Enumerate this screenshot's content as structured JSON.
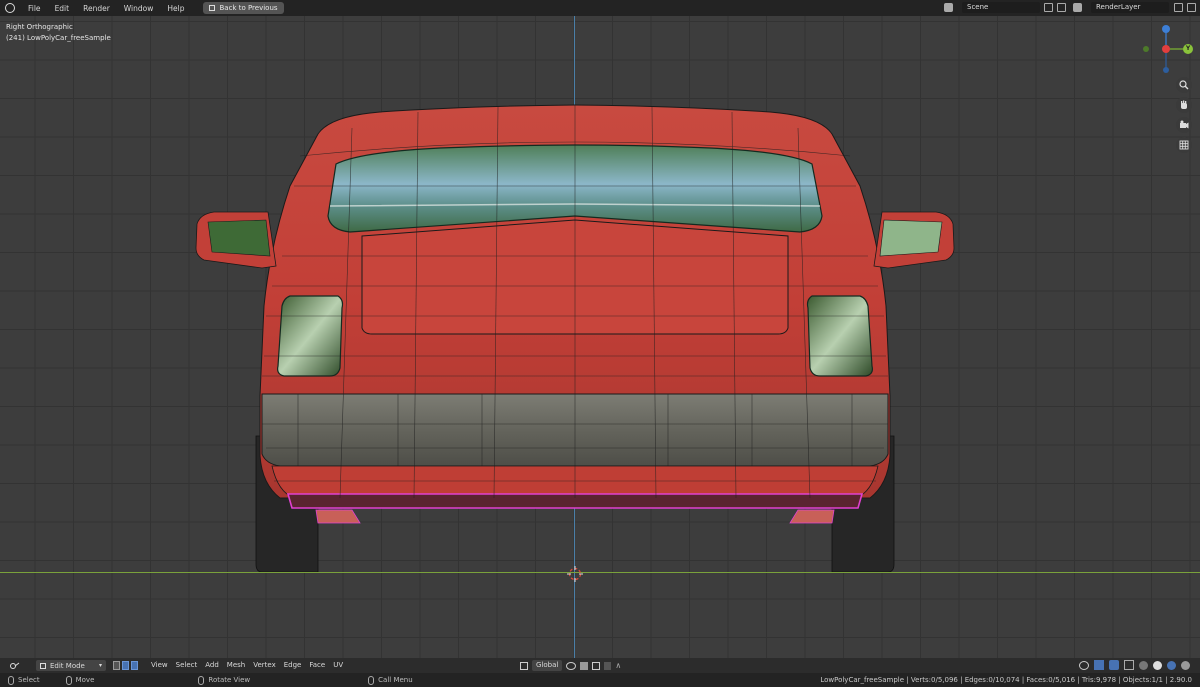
{
  "topbar": {
    "menu": [
      "File",
      "Edit",
      "Render",
      "Window",
      "Help"
    ],
    "back_label": "Back to Previous",
    "scene": "Scene",
    "render_layer": "RenderLayer"
  },
  "viewport": {
    "view_name": "Right Orthographic",
    "object_label": "(241) LowPolyCar_freeSample",
    "gizmo_axis_label": "Y"
  },
  "header": {
    "mode": "Edit Mode",
    "menus": [
      "View",
      "Select",
      "Add",
      "Mesh",
      "Vertex",
      "Edge",
      "Face",
      "UV"
    ],
    "transform_orientation": "Global"
  },
  "status": {
    "select": "Select",
    "move": "Move",
    "rotate": "Rotate View",
    "call_menu": "Call Menu",
    "stats": "LowPolyCar_freeSample | Verts:0/5,096 | Edges:0/10,074 | Faces:0/5,016 | Tris:9,978 | Objects:1/1 | 2.90.0"
  },
  "colors": {
    "body_red": "#c9423a",
    "glass": "#5a8a6a",
    "bumper_gray": "#6b6b63",
    "selected_edge": "#e040d0"
  }
}
